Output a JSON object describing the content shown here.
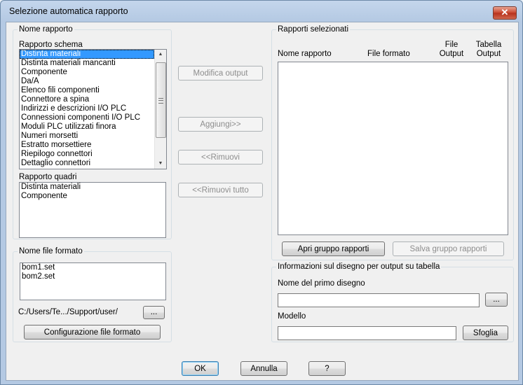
{
  "window": {
    "title": "Selezione automatica rapporto",
    "close_label": "✕"
  },
  "report_name": {
    "group_label": "Nome rapporto",
    "schematic_label": "Rapporto schema",
    "schematic_items": [
      "Distinta materiali",
      "Distinta materiali mancanti",
      "Componente",
      "Da/A",
      "Elenco fili componenti",
      "Connettore a spina",
      "Indirizzi e descrizioni I/O PLC",
      "Connessioni componenti I/O PLC",
      "Moduli PLC utilizzati finora",
      "Numeri morsetti",
      "Estratto morsettiere",
      "Riepilogo connettori",
      "Dettaglio connettori"
    ],
    "selected_index": 0,
    "panel_label": "Rapporto quadri",
    "panel_items": [
      "Distinta materiali",
      "Componente"
    ]
  },
  "format_file": {
    "group_label": "Nome file formato",
    "items": [
      "bom1.set",
      "bom2.set"
    ],
    "path": "C:/Users/Te.../Support/user/",
    "browse_label": "...",
    "config_button": "Configurazione file formato"
  },
  "middle_buttons": {
    "modify_output": "Modifica output",
    "add": "Aggiungi>>",
    "remove": "<<Rimuovi",
    "remove_all": "<<Rimuovi tutto"
  },
  "selected_reports": {
    "group_label": "Rapporti selezionati",
    "col_report_name": "Nome rapporto",
    "col_format_file": "File formato",
    "col_file_output_1": "File",
    "col_file_output_2": "Output",
    "col_table_output_1": "Tabella",
    "col_table_output_2": "Output",
    "open_group": "Apri gruppo rapporti",
    "save_group": "Salva gruppo rapporti"
  },
  "drawing_info": {
    "group_label": "Informazioni sul disegno per output su tabella",
    "first_drawing_label": "Nome del primo disegno",
    "first_drawing_value": "",
    "browse_label": "...",
    "template_label": "Modello",
    "template_value": "",
    "browse_button": "Sfoglia"
  },
  "footer": {
    "ok": "OK",
    "cancel": "Annulla",
    "help": "?"
  }
}
